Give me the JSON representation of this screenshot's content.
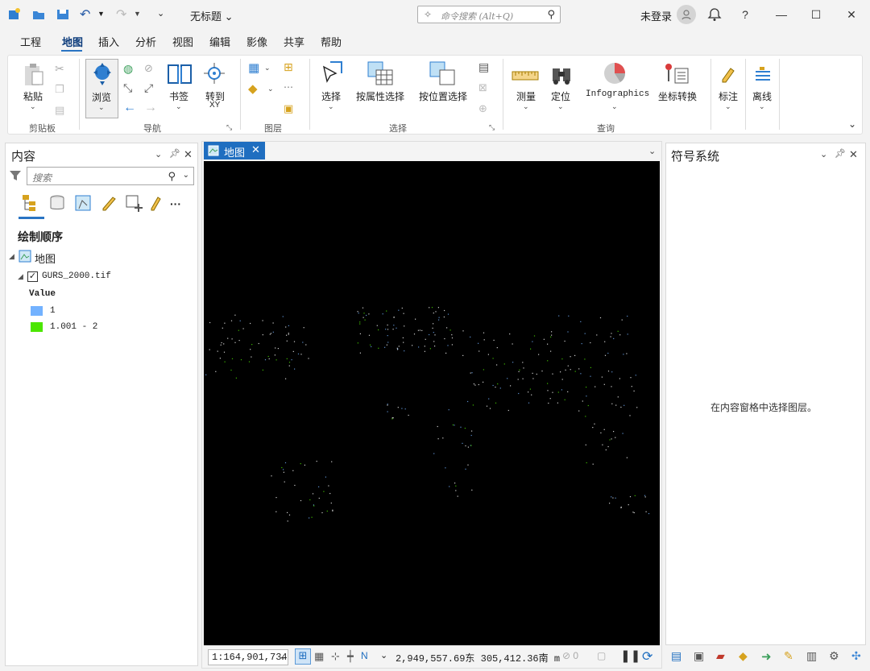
{
  "titlebar": {
    "doc_title": "无标题",
    "command_search_placeholder": "命令搜索 (Alt+Q)",
    "user_label": "未登录"
  },
  "menu": {
    "tabs": [
      "工程",
      "地图",
      "插入",
      "分析",
      "视图",
      "编辑",
      "影像",
      "共享",
      "帮助"
    ],
    "active": "地图"
  },
  "ribbon": {
    "paste": "粘贴",
    "clipboard_group": "剪贴板",
    "explore": "浏览",
    "bookmarks": "书签",
    "goto_xy_line1": "转到",
    "goto_xy_line2": "XY",
    "navigate_group": "导航",
    "layer_group": "图层",
    "select": "选择",
    "select_by_attr": "按属性选择",
    "select_by_loc": "按位置选择",
    "selection_group": "选择",
    "measure": "测量",
    "locate": "定位",
    "infographics": "Infographics",
    "coord_convert": "坐标转换",
    "inquiry_group": "查询",
    "label": "标注",
    "offline": "离线"
  },
  "contents": {
    "title": "内容",
    "search_placeholder": "搜索",
    "drawing_order": "绘制顺序",
    "map_name": "地图",
    "layer_name": "GURS_2000.tif",
    "value_header": "Value",
    "legend": [
      {
        "label": "1",
        "color": "#73b2ff"
      },
      {
        "label": "1.001 - 2",
        "color": "#4ce600"
      }
    ]
  },
  "map": {
    "tab_label": "地图",
    "scale": "1:164,901,734",
    "coordinates": "2,949,557.69东 305,412.36南 m"
  },
  "symbology": {
    "title": "符号系统",
    "hint": "在内容窗格中选择图层。"
  },
  "colors": {
    "accent": "#1f6ec0",
    "map_background": "#000000"
  }
}
